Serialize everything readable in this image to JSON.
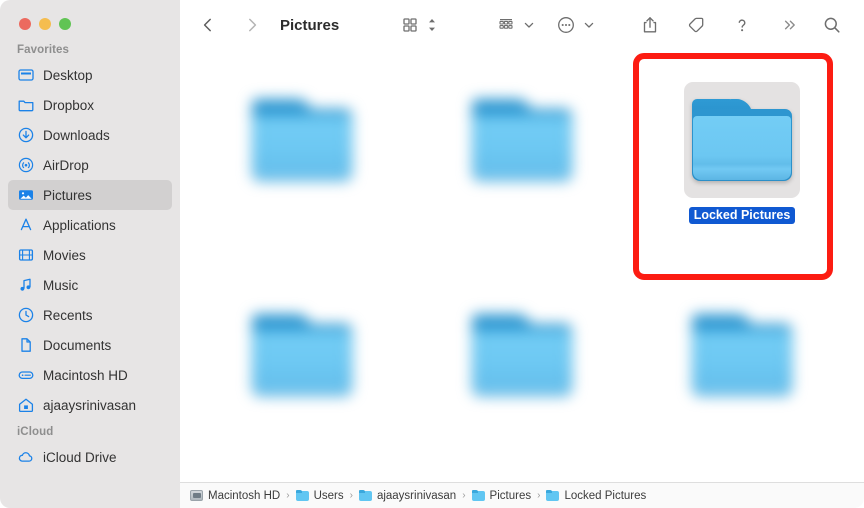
{
  "window": {
    "title": "Pictures",
    "traffic_lights": [
      "close",
      "minimize",
      "zoom"
    ]
  },
  "sidebar": {
    "sections": [
      {
        "label": "Favorites",
        "items": [
          {
            "label": "Desktop",
            "icon": "desktop-icon",
            "selected": false
          },
          {
            "label": "Dropbox",
            "icon": "folder-icon",
            "selected": false
          },
          {
            "label": "Downloads",
            "icon": "download-icon",
            "selected": false
          },
          {
            "label": "AirDrop",
            "icon": "airdrop-icon",
            "selected": false
          },
          {
            "label": "Pictures",
            "icon": "pictures-icon",
            "selected": true
          },
          {
            "label": "Applications",
            "icon": "applications-icon",
            "selected": false
          },
          {
            "label": "Movies",
            "icon": "movies-icon",
            "selected": false
          },
          {
            "label": "Music",
            "icon": "music-icon",
            "selected": false
          },
          {
            "label": "Recents",
            "icon": "clock-icon",
            "selected": false
          },
          {
            "label": "Documents",
            "icon": "document-icon",
            "selected": false
          },
          {
            "label": "Macintosh HD",
            "icon": "harddrive-icon",
            "selected": false
          },
          {
            "label": "ajaaysrinivasan",
            "icon": "home-icon",
            "selected": false
          }
        ]
      },
      {
        "label": "iCloud",
        "items": [
          {
            "label": "iCloud Drive",
            "icon": "cloud-icon",
            "selected": false
          }
        ]
      }
    ]
  },
  "toolbar": {
    "back_label": "Back",
    "forward_label": "Forward",
    "title": "Pictures",
    "view_label": "Icon View",
    "arrange_label": "Group By",
    "actions_label": "Action Menu",
    "share_label": "Share",
    "tag_label": "Tags",
    "help_label": "Help",
    "more_label": "More Toolbar Items",
    "search_label": "Search"
  },
  "files": {
    "items": [
      {
        "name": "",
        "blurred": true,
        "selected": false
      },
      {
        "name": "",
        "blurred": true,
        "selected": false
      },
      {
        "name": "Locked Pictures",
        "blurred": false,
        "selected": true
      },
      {
        "name": "",
        "blurred": true,
        "selected": false
      },
      {
        "name": "",
        "blurred": true,
        "selected": false
      },
      {
        "name": "",
        "blurred": true,
        "selected": false
      }
    ]
  },
  "annotation": {
    "color": "#fc1c12",
    "target": "Locked Pictures"
  },
  "pathbar": {
    "crumbs": [
      {
        "label": "Macintosh HD",
        "icon": "harddrive-icon"
      },
      {
        "label": "Users",
        "icon": "folder-icon"
      },
      {
        "label": "ajaaysrinivasan",
        "icon": "folder-icon"
      },
      {
        "label": "Pictures",
        "icon": "folder-icon"
      },
      {
        "label": "Locked Pictures",
        "icon": "folder-icon"
      }
    ],
    "separator": "›"
  },
  "colors": {
    "accent": "#1059d2",
    "sidebar_bg": "#e7e5e5",
    "annotation": "#fc1c12",
    "folder_blue": "#6cc7f2"
  }
}
